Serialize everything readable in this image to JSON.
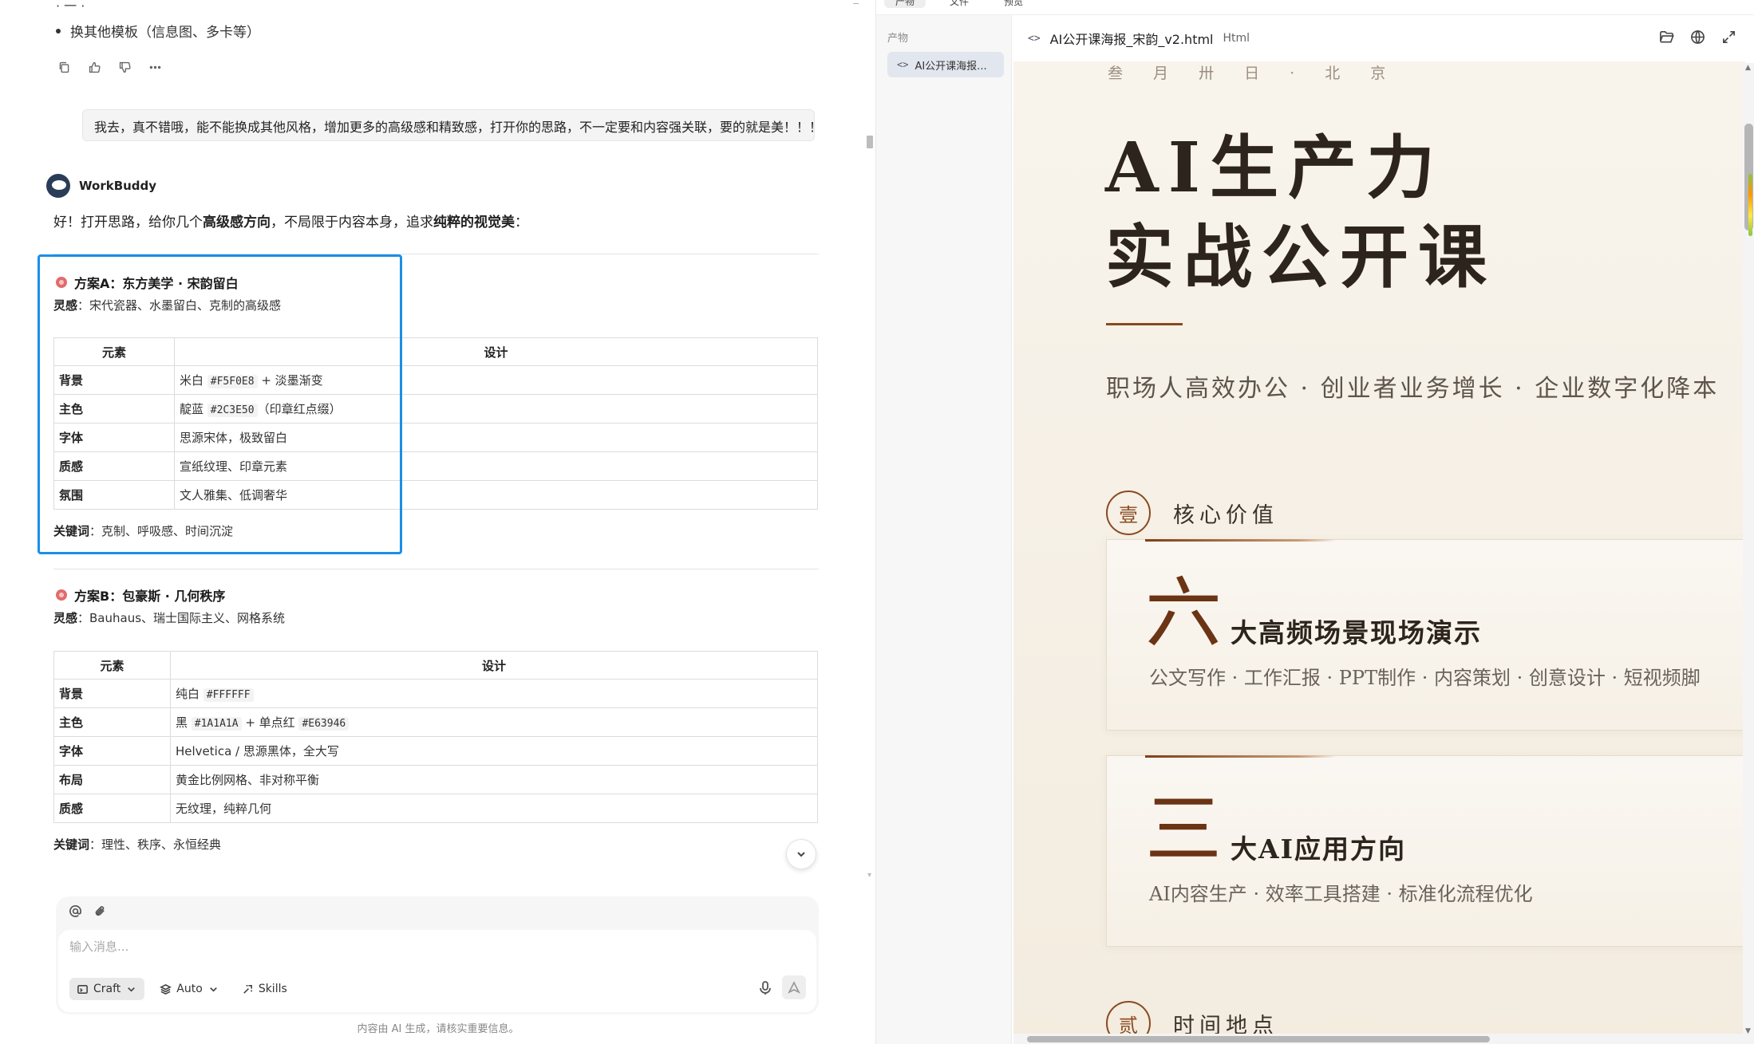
{
  "chat": {
    "cut_text": "· 一 ·",
    "prev_bullet": "换其他模板（信息图、多卡等）",
    "user_message": "我去，真不错哦，能不能换成其他风格，增加更多的高级感和精致感，打开你的思路，不一定要和内容强关联，要的就是美！！！",
    "bot_name": "WorkBuddy",
    "intro_prefix": "好！打开思路，给你几个",
    "intro_bold1": "高级感方向",
    "intro_mid": "，不局限于内容本身，追求",
    "intro_bold2": "纯粹的视觉美",
    "intro_suffix": "：",
    "plan_a": {
      "title": "方案A：东方美学 · 宋韵留白",
      "insp_label": "灵感",
      "insp": "：宋代瓷器、水墨留白、克制的高级感",
      "headers": [
        "元素",
        "设计"
      ],
      "rows": [
        {
          "k": "背景",
          "pre": "米白 ",
          "code": "#F5F0E8",
          "post": " + 淡墨渐变"
        },
        {
          "k": "主色",
          "pre": "靛蓝 ",
          "code": "#2C3E50",
          "post": "（印章红点缀）"
        },
        {
          "k": "字体",
          "pre": "思源宋体，极致留白",
          "code": "",
          "post": ""
        },
        {
          "k": "质感",
          "pre": "宣纸纹理、印章元素",
          "code": "",
          "post": ""
        },
        {
          "k": "氛围",
          "pre": "文人雅集、低调奢华",
          "code": "",
          "post": ""
        }
      ],
      "kw_label": "关键词",
      "kw": "：克制、呼吸感、时间沉淀"
    },
    "plan_b": {
      "title": "方案B：包豪斯 · 几何秩序",
      "insp_label": "灵感",
      "insp": "：Bauhaus、瑞士国际主义、网格系统",
      "headers": [
        "元素",
        "设计"
      ],
      "rows": [
        {
          "k": "背景",
          "pre": "纯白 ",
          "code": "#FFFFFF",
          "post": ""
        },
        {
          "k": "主色",
          "pre": "黑 ",
          "code": "#1A1A1A",
          "post": " + 单点红 ",
          "code2": "#E63946"
        },
        {
          "k": "字体",
          "pre": "Helvetica / 思源黑体，全大写",
          "code": "",
          "post": ""
        },
        {
          "k": "布局",
          "pre": "黄金比例网格、非对称平衡",
          "code": "",
          "post": ""
        },
        {
          "k": "质感",
          "pre": "无纹理，纯粹几何",
          "code": "",
          "post": ""
        }
      ],
      "kw_label": "关键词",
      "kw": "：理性、秩序、永恒经典"
    },
    "composer": {
      "placeholder": "输入消息...",
      "craft": "Craft",
      "auto": "Auto",
      "skills": "Skills"
    },
    "disclaimer": "内容由 AI 生成，请核实重要信息。"
  },
  "artifacts": {
    "tabs": [
      "产物",
      "文件",
      "预览"
    ],
    "side_label": "产物",
    "side_item": "AI公开课海报...",
    "file_name": "AI公开课海报_宋韵_v2.html",
    "file_type": "Html",
    "poster": {
      "date": "叁 月 卅 日 · 北 京",
      "title_line1": "AI生产力",
      "title_line2": "实战公开课",
      "subtitle": "职场人高效办公 · 创业者业务增长 · 企业数字化降本",
      "sec1_num": "壹",
      "sec1_title": "核心价值",
      "card1_big": "六",
      "card1_title": "大高频场景现场演示",
      "card1_desc": "公文写作 · 工作汇报 · PPT制作 · 内容策划 · 创意设计 · 短视频脚",
      "card2_big": "三",
      "card2_title": "大AI应用方向",
      "card2_desc": "AI内容生产 · 效率工具搭建 · 标准化流程优化",
      "sec2_num": "贰",
      "sec2_title": "时间地点"
    }
  },
  "colors": {
    "highlight": "#1a8fe8",
    "poster_bg": "#f5efe5",
    "accent_brown": "#8a4a1f",
    "title_ink": "#2d251d"
  }
}
